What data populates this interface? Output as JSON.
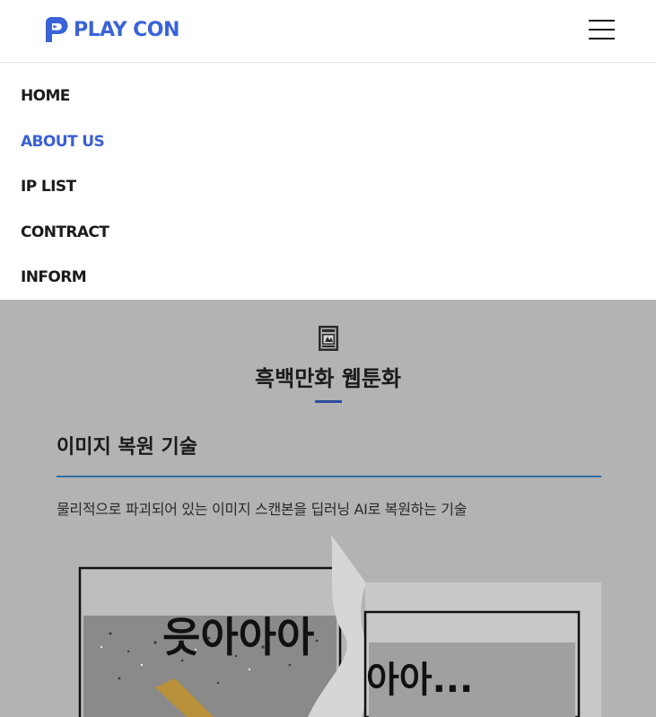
{
  "header": {
    "logo_text": "PLAY CON",
    "menu_icon": "hamburger-menu-icon",
    "brand_color": "#3a63d8"
  },
  "nav": {
    "items": [
      {
        "label": "HOME",
        "active": false
      },
      {
        "label": "ABOUT US",
        "active": true
      },
      {
        "label": "IP LIST",
        "active": false
      },
      {
        "label": "CONTRACT",
        "active": false
      },
      {
        "label": "INFORM",
        "active": false
      }
    ],
    "active_color": "#3a5fd3"
  },
  "section": {
    "icon": "book-icon",
    "title": "흑백만화 웹툰화",
    "subtitle": "이미지 복원 기술",
    "description": "물리적으로 파괴되어 있는 이미지 스캔본을 딥러닝 AI로 복원하는 기술",
    "illustration_text_left": "읏아아아",
    "illustration_text_right": "아아..."
  }
}
